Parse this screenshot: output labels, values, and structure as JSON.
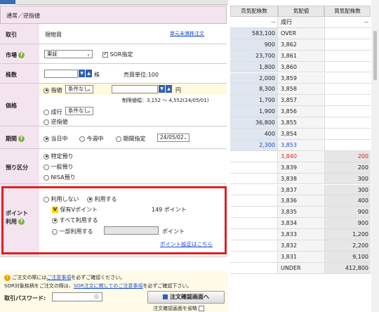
{
  "order_form": {
    "title": "通常／逆指値",
    "trade": {
      "label": "取引",
      "value": "現物買",
      "link": "単元未満株注文"
    },
    "market": {
      "label": "市場",
      "select": "東証",
      "sor_label": "SOR指定",
      "sor_checked": true
    },
    "quantity": {
      "label": "株数",
      "unit": "株",
      "unit_info": "売買単位:100",
      "value": ""
    },
    "price": {
      "label": "価格",
      "limit_label": "指値",
      "limit_condition": "条件なし",
      "unit": "円",
      "limit_range": "制限値幅：3,152 ～ 4,552(24/05/01)",
      "market_label": "成行",
      "market_condition": "条件なし",
      "stop_label": "逆指値",
      "selected": "指値"
    },
    "period": {
      "label": "期間",
      "options": [
        "当日中",
        "今週中",
        "期間指定"
      ],
      "date": "24/05/02",
      "selected": "当日中"
    },
    "account": {
      "label": "預り区分",
      "options": [
        "特定預り",
        "一般預り",
        "NISA預り"
      ],
      "selected": "特定預り"
    },
    "points": {
      "label_line1": "ポイント",
      "label_line2": "利用",
      "use_options": [
        "利用しない",
        "利用する"
      ],
      "use_selected": "利用する",
      "holding_label": "保有Vポイント",
      "holding_value": "149 ポイント",
      "all_label": "すべて利用する",
      "partial_label": "一部利用する",
      "partial_unit": "ポイント",
      "partial_value": "",
      "settings_link": "ポイント設定はこちら"
    },
    "notice": {
      "line1_pre": "ご注文の際には",
      "line1_link": "ご注意事項",
      "line1_post": "を必ずご確認ください。",
      "line2_pre": "SOR対象銘柄をご注文の際は、",
      "line2_link": "SOR注文に関してのご注意事項",
      "line2_post": "を必ずご確認下さい。"
    },
    "password": {
      "label": "取引パスワード:",
      "value": ""
    },
    "confirm_button": "注文確認画面へ",
    "skip_label": "注文確認画面を省略",
    "skip_checked": false
  },
  "board": {
    "headers": [
      "売気配株数",
      "気配値",
      "買気配株数"
    ],
    "rows": [
      {
        "sell": "--",
        "price": "成行",
        "buy": "--"
      },
      {
        "sell": "583,100",
        "price": "OVER",
        "buy": ""
      },
      {
        "sell": "900",
        "price": "3,862",
        "buy": ""
      },
      {
        "sell": "23,700",
        "price": "3,861",
        "buy": ""
      },
      {
        "sell": "1,800",
        "price": "3,860",
        "buy": ""
      },
      {
        "sell": "2,000",
        "price": "3,859",
        "buy": ""
      },
      {
        "sell": "8,300",
        "price": "3,858",
        "buy": ""
      },
      {
        "sell": "1,700",
        "price": "3,857",
        "buy": ""
      },
      {
        "sell": "1,900",
        "price": "3,856",
        "buy": ""
      },
      {
        "sell": "36,800",
        "price": "3,855",
        "buy": ""
      },
      {
        "sell": "400",
        "price": "3,854",
        "buy": ""
      },
      {
        "sell": "2,300",
        "price": "3,853",
        "buy": "",
        "highlight": "blue"
      },
      {
        "sell": "",
        "price": "3,840",
        "buy": "200",
        "highlight": "red"
      },
      {
        "sell": "",
        "price": "3,839",
        "buy": "200"
      },
      {
        "sell": "",
        "price": "3,838",
        "buy": "300"
      },
      {
        "sell": "",
        "price": "3,837",
        "buy": "300"
      },
      {
        "sell": "",
        "price": "3,836",
        "buy": "400"
      },
      {
        "sell": "",
        "price": "3,835",
        "buy": "900"
      },
      {
        "sell": "",
        "price": "3,834",
        "buy": "900"
      },
      {
        "sell": "",
        "price": "3,833",
        "buy": "1,200"
      },
      {
        "sell": "",
        "price": "3,832",
        "buy": "2,200"
      },
      {
        "sell": "",
        "price": "3,831",
        "buy": "9,100"
      },
      {
        "sell": "",
        "price": "UNDER",
        "buy": "412,800"
      }
    ]
  },
  "colors": {
    "accent_red": "#e02020",
    "link_blue": "#1a4fd6",
    "label_bg": "#f4e4f0"
  }
}
